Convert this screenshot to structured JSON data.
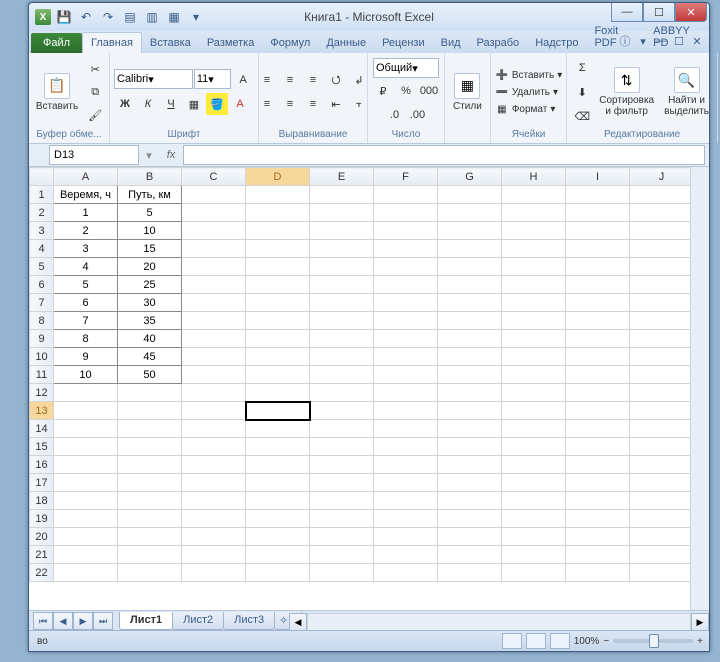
{
  "title": "Книга1 - Microsoft Excel",
  "tabs": {
    "file": "Файл",
    "home": "Главная",
    "insert": "Вставка",
    "layout": "Разметка",
    "formulas": "Формул",
    "data": "Данные",
    "review": "Рецензи",
    "view": "Вид",
    "dev": "Разрабо",
    "addins": "Надстро",
    "foxit": "Foxit PDF",
    "abbyy": "ABBYY PD"
  },
  "ribbon": {
    "clipboard": {
      "paste": "Вставить",
      "label": "Буфер обме..."
    },
    "font": {
      "name": "Calibri",
      "size": "11",
      "label": "Шрифт"
    },
    "align": {
      "label": "Выравнивание"
    },
    "number": {
      "format": "Общий",
      "label": "Число"
    },
    "styles": {
      "btn": "Стили",
      "label": ""
    },
    "cells": {
      "insert": "Вставить",
      "delete": "Удалить",
      "format": "Формат",
      "label": "Ячейки"
    },
    "editing": {
      "sort": "Сортировка\nи фильтр",
      "find": "Найти и\nвыделить",
      "label": "Редактирование"
    }
  },
  "namebox": "D13",
  "columns": [
    "A",
    "B",
    "C",
    "D",
    "E",
    "F",
    "G",
    "H",
    "I",
    "J"
  ],
  "headers": {
    "a": "Веремя, ч",
    "b": "Путь, км"
  },
  "rows": [
    {
      "a": "1",
      "b": "5"
    },
    {
      "a": "2",
      "b": "10"
    },
    {
      "a": "3",
      "b": "15"
    },
    {
      "a": "4",
      "b": "20"
    },
    {
      "a": "5",
      "b": "25"
    },
    {
      "a": "6",
      "b": "30"
    },
    {
      "a": "7",
      "b": "35"
    },
    {
      "a": "8",
      "b": "40"
    },
    {
      "a": "9",
      "b": "45"
    },
    {
      "a": "10",
      "b": "50"
    }
  ],
  "selected_cell": "D13",
  "sheets": {
    "s1": "Лист1",
    "s2": "Лист2",
    "s3": "Лист3"
  },
  "status": {
    "ready": "во",
    "zoom": "100%"
  }
}
